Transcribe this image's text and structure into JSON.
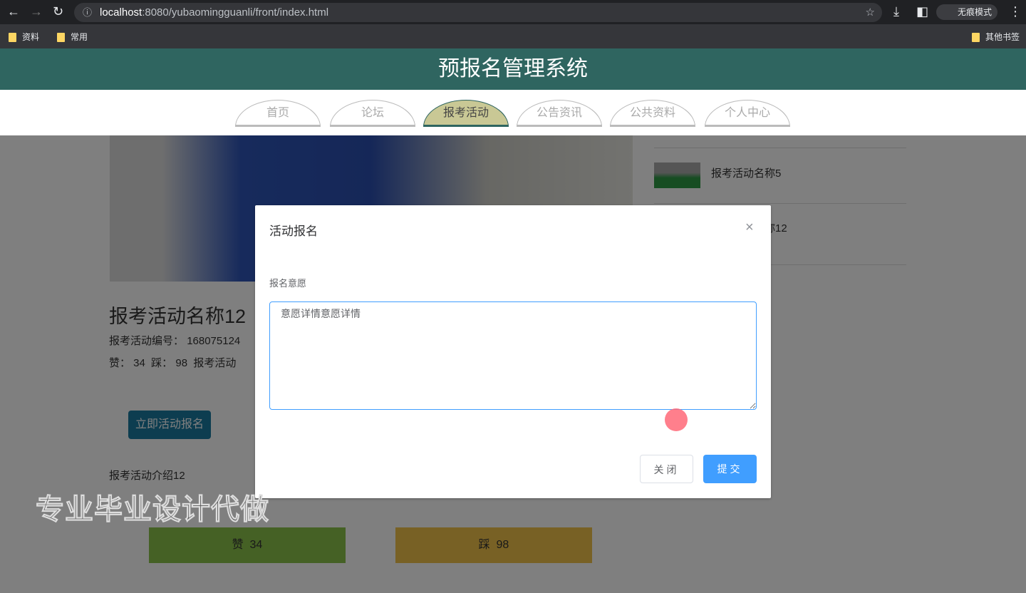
{
  "browser": {
    "url_host": "localhost",
    "url_rest": ":8080/yubaomingguanli/front/index.html",
    "incognito_label": "无痕模式",
    "bookmarks": [
      "资料",
      "常用"
    ],
    "other_bookmarks": "其他书签"
  },
  "header": {
    "title": "预报名管理系统"
  },
  "nav": {
    "tabs": [
      "首页",
      "论坛",
      "报考活动",
      "公告资讯",
      "公共资料",
      "个人中心"
    ],
    "active": 2
  },
  "detail": {
    "title": "报考活动名称12",
    "code_label": "报考活动编号：",
    "code_value": "168075124",
    "likes_line": "赞： 34  踩： 98  报考活动",
    "signup_button": "立即活动报名",
    "intro": "报考活动介绍12",
    "like_bar": "赞  34",
    "dislike_bar": "踩  98"
  },
  "sidebar": {
    "items": [
      {
        "title": "报考活动名称5"
      },
      {
        "title": "报考活动名称12"
      }
    ]
  },
  "modal": {
    "title": "活动报名",
    "field_label": "报名意愿",
    "textarea_value": "意愿详情意愿详情",
    "close_button": "关闭",
    "submit_button": "提交"
  },
  "watermark": "专业毕业设计代做",
  "colors": {
    "header": "#2f6560",
    "active_tab": "#c9c895",
    "primary": "#409eff",
    "like": "#8bc34a",
    "dislike": "#f0c24a"
  }
}
